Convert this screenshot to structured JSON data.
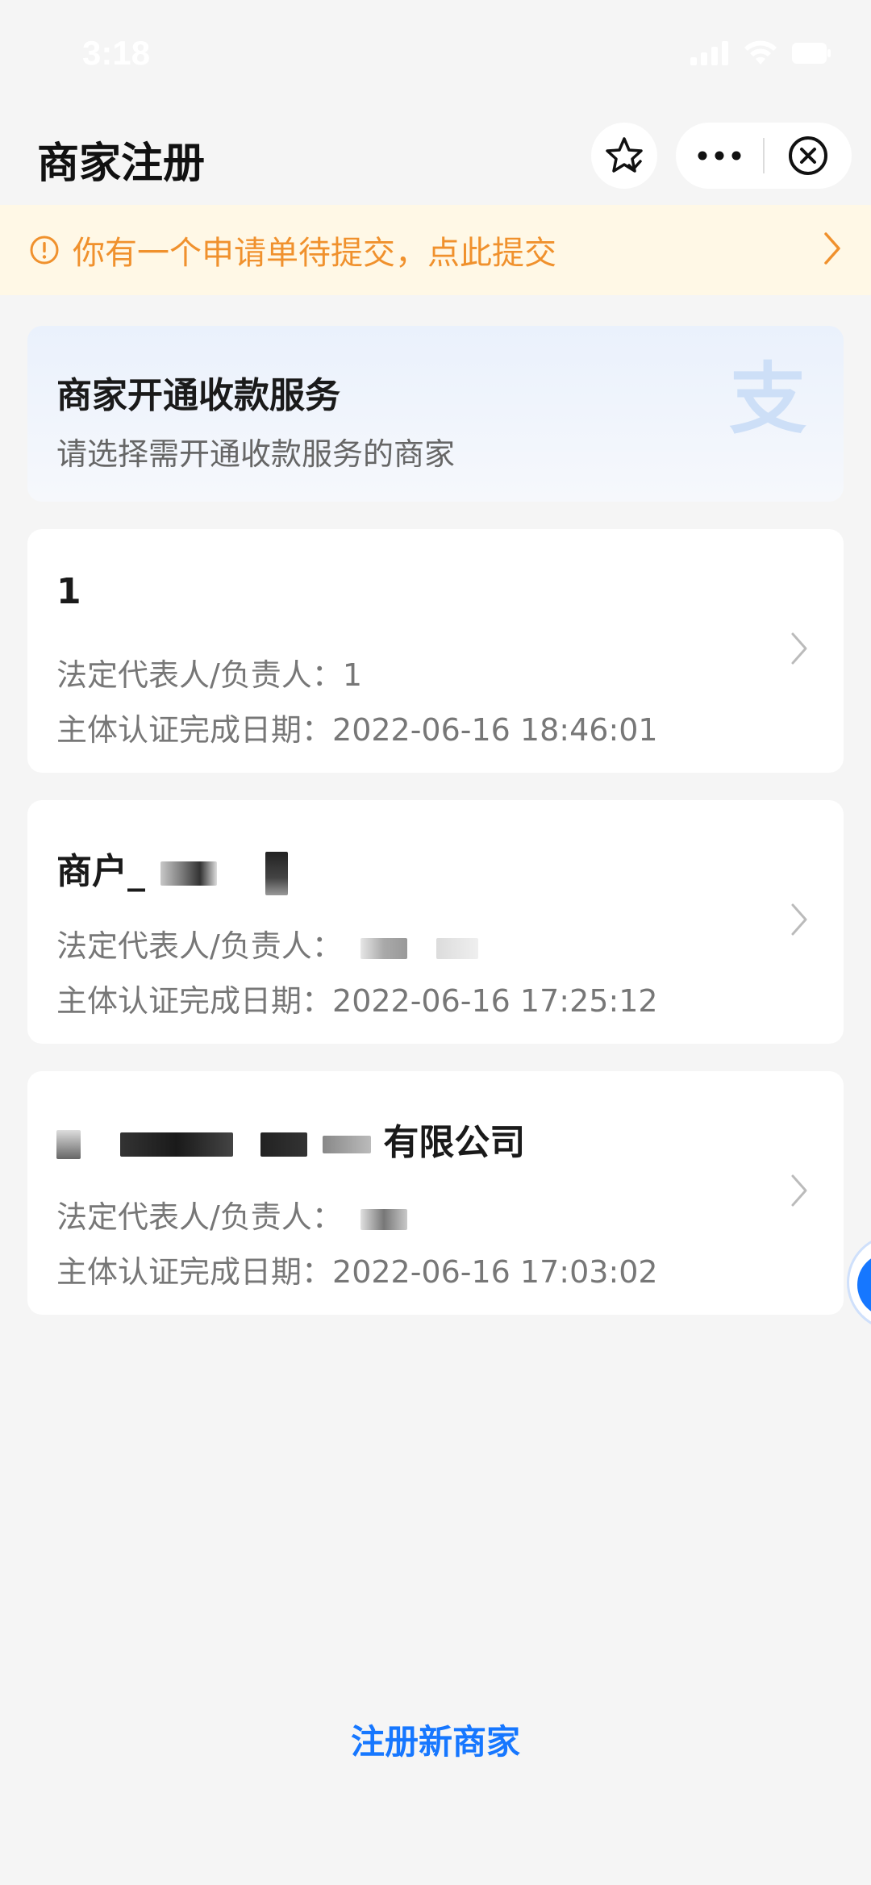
{
  "status_bar": {
    "time": "3:18"
  },
  "nav": {
    "title": "商家注册"
  },
  "notice": {
    "text": "你有一个申请单待提交，点此提交"
  },
  "hero": {
    "title": "商家开通收款服务",
    "subtitle": "请选择需开通收款服务的商家",
    "logo_glyph": "支"
  },
  "merchants": [
    {
      "name": "1",
      "rep_label": "法定代表人/负责人：",
      "rep_value": "1",
      "date_label": "主体认证完成日期：",
      "date_value": "2022-06-16 18:46:01"
    },
    {
      "name": "商户_",
      "rep_label": "法定代表人/负责人：",
      "rep_value": "",
      "date_label": "主体认证完成日期：",
      "date_value": "2022-06-16 17:25:12"
    },
    {
      "name": "有限公司",
      "rep_label": "法定代表人/负责人：",
      "rep_value": "",
      "date_label": "主体认证完成日期：",
      "date_value": "2022-06-16 17:03:02"
    }
  ],
  "footer": {
    "register_label": "注册新商家"
  },
  "colors": {
    "accent": "#1677ff",
    "notice_text": "#f0912d",
    "notice_bg": "#fff8e6"
  }
}
